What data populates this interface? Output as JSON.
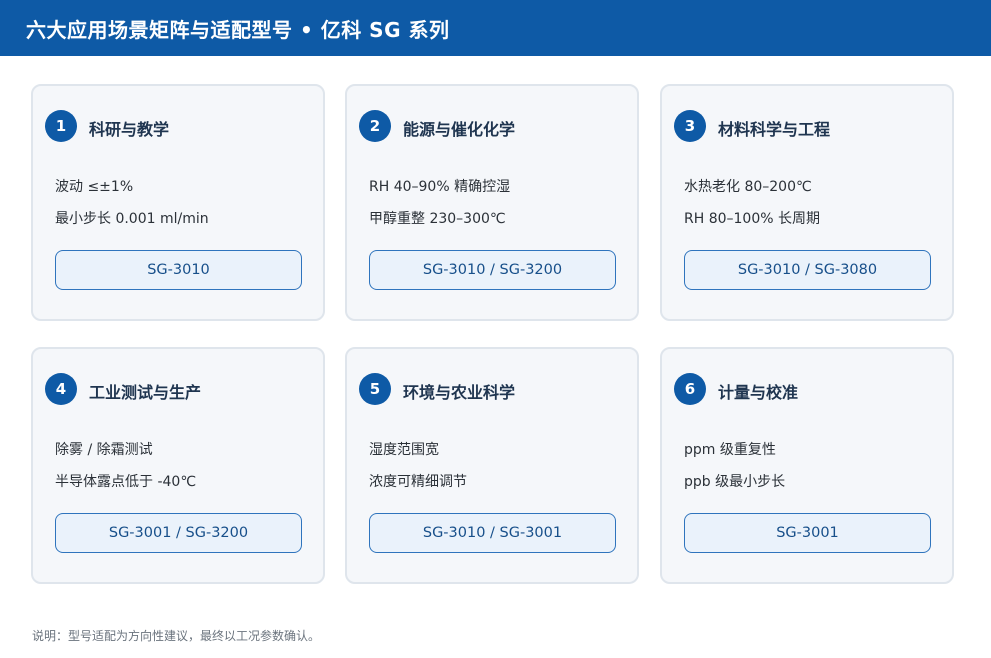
{
  "header": {
    "title": "六大应用场景矩阵与适配型号 • 亿科 SG 系列"
  },
  "cards": [
    {
      "number": "1",
      "title": "科研与教学",
      "lines": [
        "波动 ≤±1%",
        "最小步长 0.001 ml/min"
      ],
      "models": "SG-3010"
    },
    {
      "number": "2",
      "title": "能源与催化化学",
      "lines": [
        "RH 40–90% 精确控湿",
        "甲醇重整 230–300℃"
      ],
      "models": "SG-3010 / SG-3200"
    },
    {
      "number": "3",
      "title": "材料科学与工程",
      "lines": [
        "水热老化 80–200℃",
        "RH 80–100% 长周期"
      ],
      "models": "SG-3010 / SG-3080"
    },
    {
      "number": "4",
      "title": "工业测试与生产",
      "lines": [
        "除雾 / 除霜测试",
        "半导体露点低于 -40℃"
      ],
      "models": "SG-3001 / SG-3200"
    },
    {
      "number": "5",
      "title": "环境与农业科学",
      "lines": [
        "湿度范围宽",
        "浓度可精细调节"
      ],
      "models": "SG-3010 / SG-3001"
    },
    {
      "number": "6",
      "title": "计量与校准",
      "lines": [
        "ppm 级重复性",
        "ppb 级最小步长"
      ],
      "models": "SG-3001"
    }
  ],
  "footnote": "说明：型号适配为方向性建议，最终以工况参数确认。",
  "colors": {
    "brand": "#0e5aa6",
    "card_bg": "#f5f7fa",
    "button_bg": "#eaf2fb",
    "button_border": "#2f74bd"
  }
}
